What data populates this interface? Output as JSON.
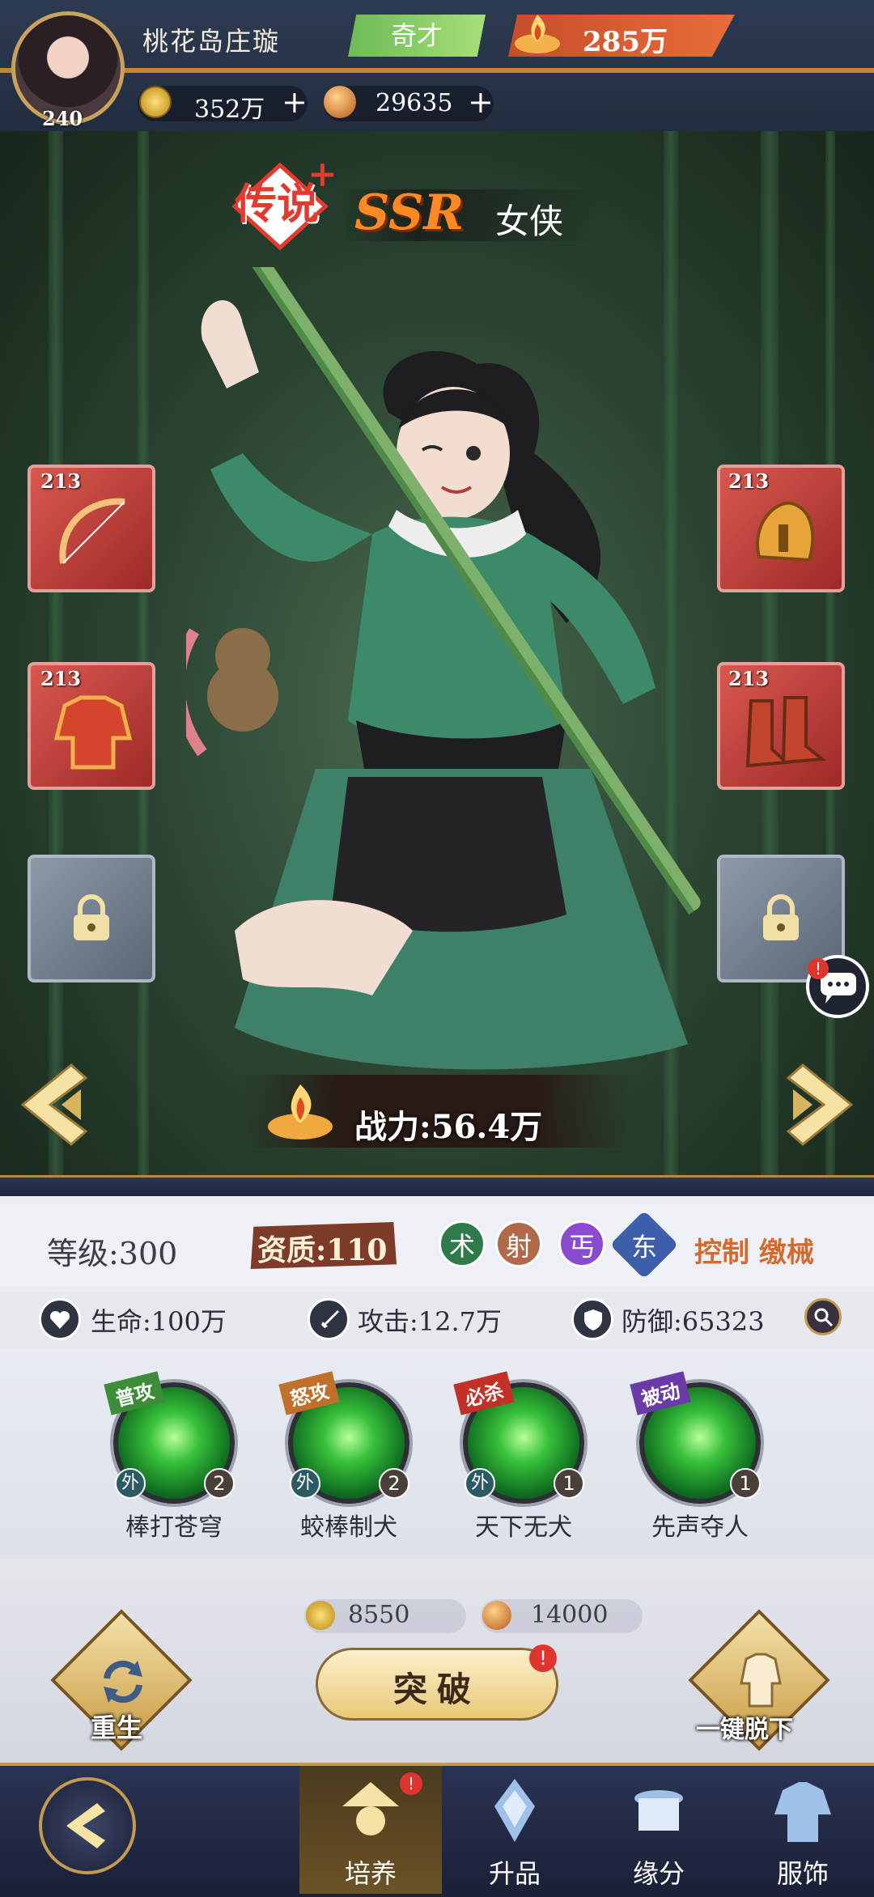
{
  "player": {
    "name": "桃花岛庄璇",
    "avatar_level": "240",
    "title": "奇才",
    "power": "285万"
  },
  "resources": {
    "coins": "352万",
    "orbs": "29635",
    "plus": "+"
  },
  "hero": {
    "rank": "传说",
    "rank_plus": "+",
    "rarity": "SSR",
    "role": "女侠",
    "combat_power": "战力:56.4万"
  },
  "equipment": {
    "slot_level": "213"
  },
  "stats": {
    "level": "等级:300",
    "quality": "资质:110",
    "tags": [
      "术",
      "射",
      "丐",
      "东"
    ],
    "roles": "控制 缴械",
    "hp": "生命:100万",
    "attack": "攻击:12.7万",
    "defense": "防御:65323"
  },
  "skills": [
    {
      "type": "普攻",
      "type_color": "#3c8c3a",
      "name": "棒打苍穹",
      "count": "2",
      "mark": "外"
    },
    {
      "type": "怒攻",
      "type_color": "#c0702a",
      "name": "蛟棒制犬",
      "count": "2",
      "mark": "外"
    },
    {
      "type": "必杀",
      "type_color": "#c23028",
      "name": "天下无犬",
      "count": "1",
      "mark": "外"
    },
    {
      "type": "被动",
      "type_color": "#6a3aa8",
      "name": "先声夺人",
      "count": "1"
    }
  ],
  "breakthrough": {
    "cost_coins": "8550",
    "cost_orbs": "14000",
    "label": "突破",
    "badge": "!"
  },
  "actions": {
    "rebirth": "重生",
    "unequip_all": "一键脱下"
  },
  "nav": {
    "tabs": [
      "培养",
      "升品",
      "缘分",
      "服饰"
    ],
    "active": 0,
    "badge": "!"
  },
  "colors": {
    "accent_gold": "#c39a52",
    "power_red": "#d9542b",
    "title_green": "#6dbb56"
  }
}
